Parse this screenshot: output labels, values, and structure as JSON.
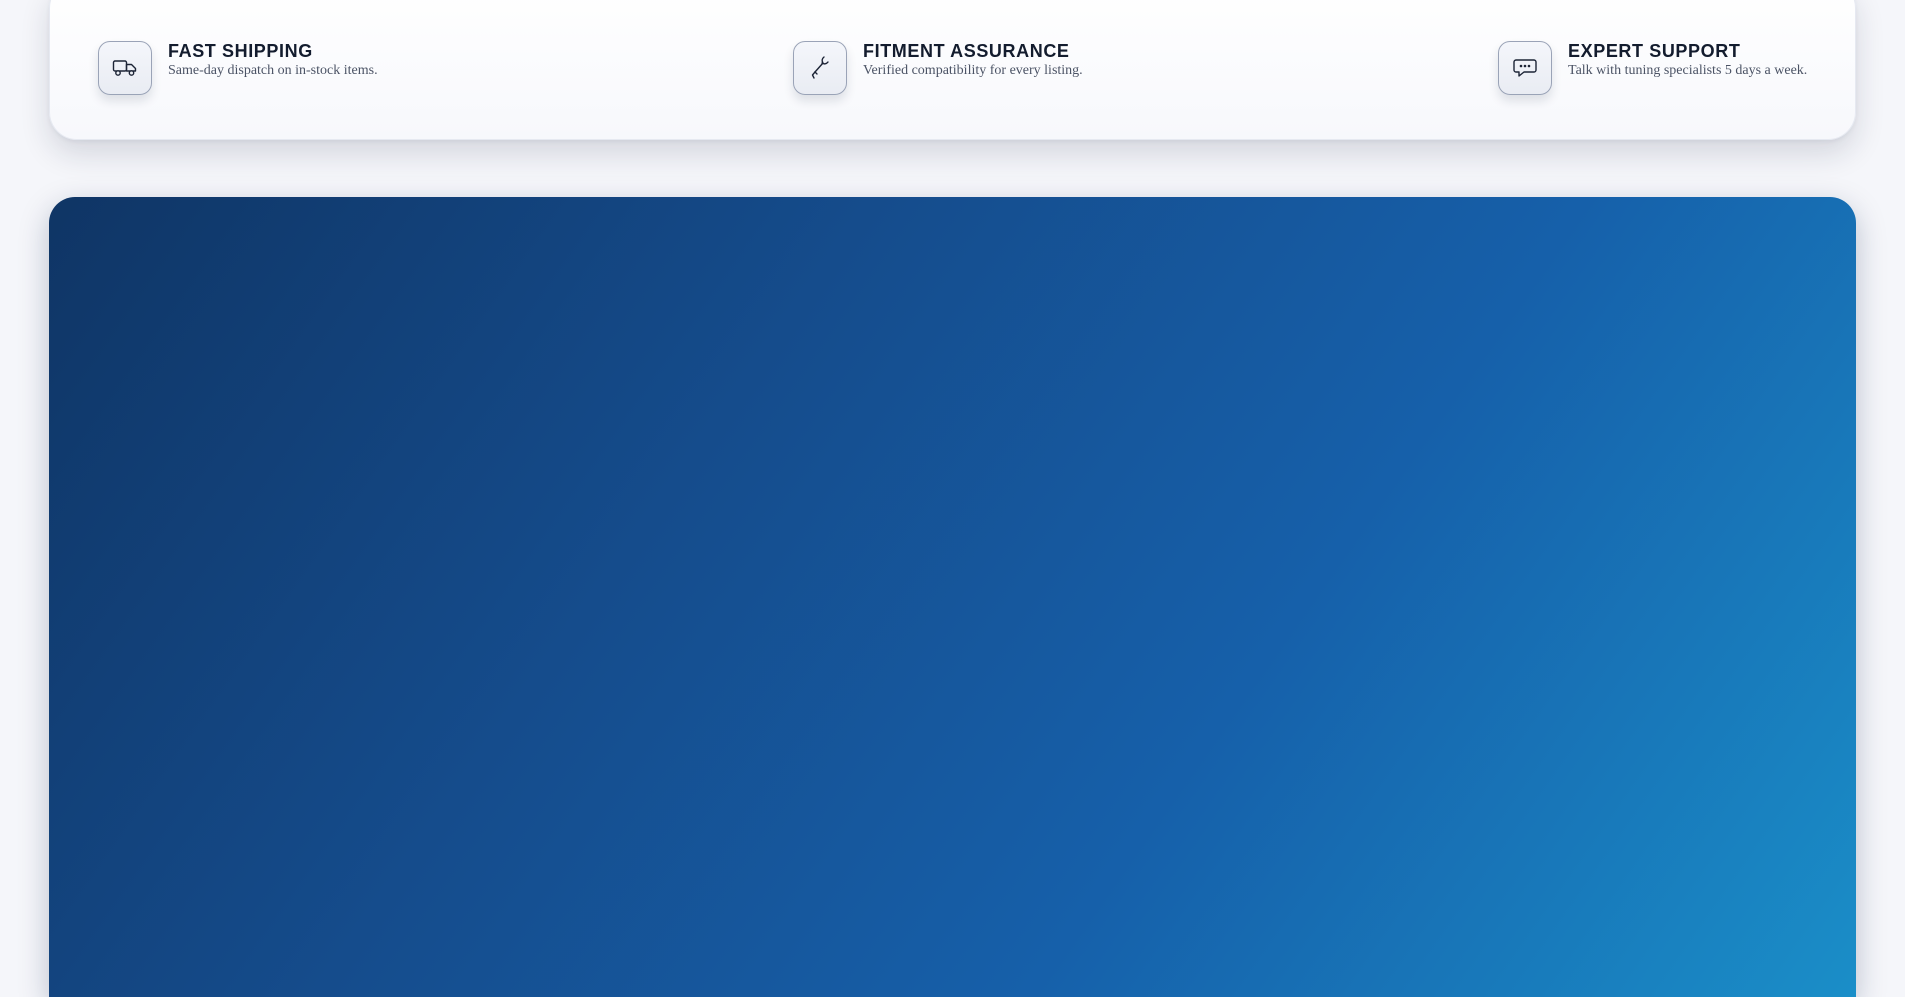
{
  "features": [
    {
      "icon": "truck-icon",
      "title": "FAST SHIPPING",
      "description": "Same-day dispatch on in-stock items."
    },
    {
      "icon": "wrench-icon",
      "title": "FITMENT ASSURANCE",
      "description": "Verified compatibility for every listing."
    },
    {
      "icon": "chat-bubble-icon",
      "title": "EXPERT SUPPORT",
      "description": "Talk with tuning specialists 5 days a week."
    }
  ],
  "colors": {
    "page_background": "#f5f6fa",
    "title_text": "#131c2e",
    "description_text": "#4b5365",
    "hero_gradient_start": "#0f3565",
    "hero_gradient_end": "#1a8ec8"
  }
}
